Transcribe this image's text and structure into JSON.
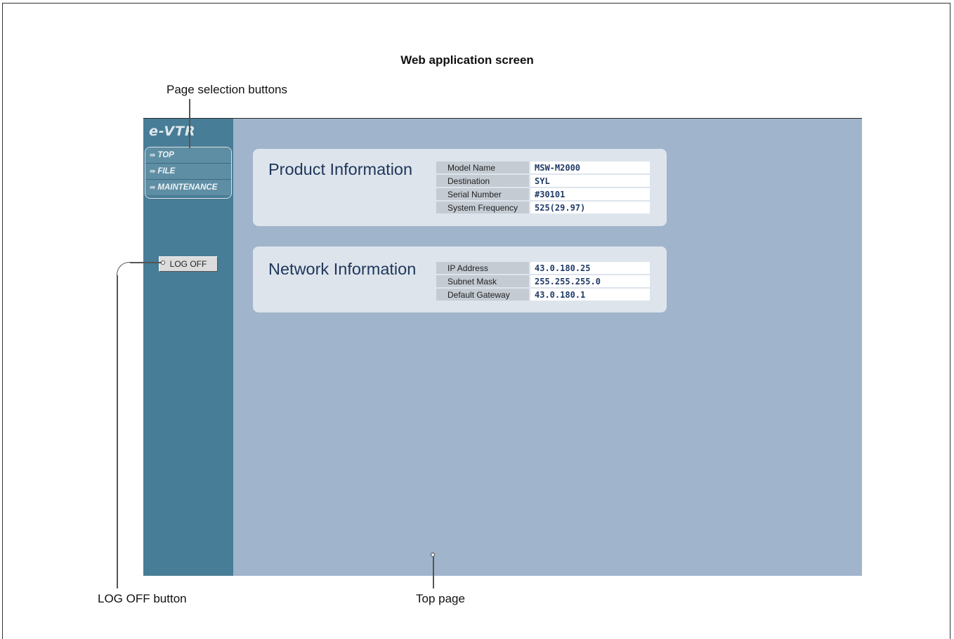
{
  "caption": "Web application screen",
  "callouts": {
    "page_selection": "Page selection buttons",
    "logoff": "LOG OFF button",
    "top_page": "Top page"
  },
  "app": {
    "logo": "e-VTR",
    "nav": [
      {
        "label": "TOP",
        "icon": "arrow-icon"
      },
      {
        "label": "FILE",
        "icon": "arrow-icon"
      },
      {
        "label": "MAINTENANCE",
        "icon": "arrow-icon"
      }
    ],
    "logoff_label": "LOG OFF",
    "product": {
      "title": "Product Information",
      "rows": [
        {
          "label": "Model Name",
          "value": "MSW-M2000"
        },
        {
          "label": "Destination",
          "value": "SYL"
        },
        {
          "label": "Serial Number",
          "value": "#30101"
        },
        {
          "label": "System Frequency",
          "value": "525(29.97)"
        }
      ]
    },
    "network": {
      "title": "Network Information",
      "rows": [
        {
          "label": "IP Address",
          "value": "43.0.180.25"
        },
        {
          "label": "Subnet Mask",
          "value": "255.255.255.0"
        },
        {
          "label": "Default Gateway",
          "value": "43.0.180.1"
        }
      ]
    }
  },
  "colors": {
    "sidebar": "#477d96",
    "content": "#a0b4cb",
    "panel": "#dde4ec",
    "value_text": "#1f3a66"
  }
}
